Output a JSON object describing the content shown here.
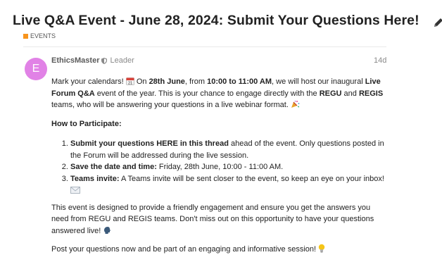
{
  "topic": {
    "title": "Live Q&A Event - June 28, 2024: Submit Your Questions Here!",
    "category": "EVENTS",
    "category_color": "#f7941d",
    "edit_icon": "pencil-icon"
  },
  "post": {
    "avatar_letter": "E",
    "avatar_color": "#e182e6",
    "username": "EthicsMaster",
    "moderator_icon": "shield-icon",
    "user_title": "Leader",
    "date": "14d"
  },
  "content": {
    "p1": {
      "t1": "Mark your calendars! ",
      "calendar_icon": "calendar-icon",
      "t2": " On ",
      "b1": "28th June",
      "t3": ", from ",
      "b2": "10:00 to 11:00 AM",
      "t4": ", we will host our inaugural ",
      "b3": "Live Forum Q&A",
      "t5": " event of the year. This is your chance to engage directly with the ",
      "b4": "REGU",
      "t6": " and ",
      "b5": "REGIS",
      "t7": " teams, who will be answering your questions in a live webinar format. ",
      "party_icon": "party-popper-icon"
    },
    "how_heading": "How to Participate:",
    "steps": [
      {
        "bold": "Submit your questions HERE in this thread",
        "text": " ahead of the event. Only questions posted in the Forum will be addressed during the live session."
      },
      {
        "bold": "Save the date and time:",
        "text": " Friday, 28th June, 10:00 - 11:00 AM."
      },
      {
        "bold": "Teams invite:",
        "text": " A Teams invite will be sent closer to the event, so keep an eye on your inbox! ",
        "icon": "envelope-icon"
      }
    ],
    "p3": {
      "text": "This event is designed to provide a friendly engagement and ensure you get the answers you need from REGU and REGIS teams. Don't miss out on this opportunity to have your questions answered live! ",
      "icon": "speaking-head-icon"
    },
    "p4": {
      "text": "Post your questions now and be part of an engaging and informative session! ",
      "icon": "lightbulb-icon"
    }
  }
}
